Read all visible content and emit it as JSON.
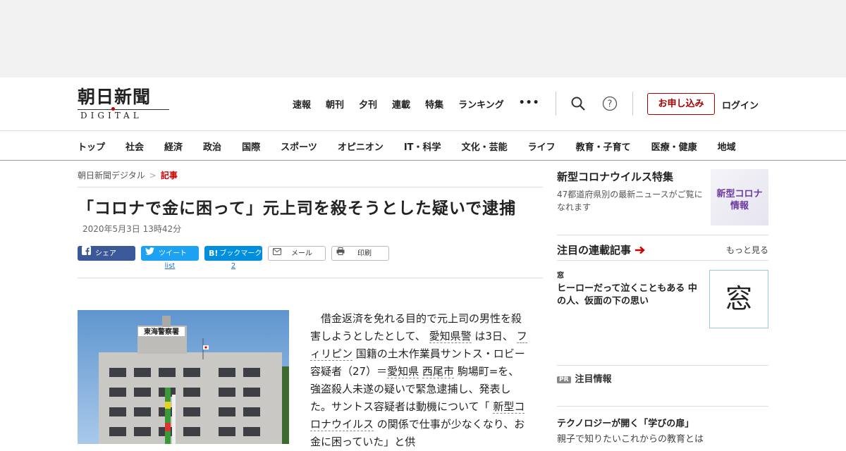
{
  "logo": {
    "title": "朝日新聞",
    "sub": "DIGITAL"
  },
  "topnav": [
    "速報",
    "朝刊",
    "夕刊",
    "連載",
    "特集",
    "ランキング",
    "•••"
  ],
  "header": {
    "signup": "お申し込み",
    "login": "ログイン"
  },
  "categories": [
    "トップ",
    "社会",
    "経済",
    "政治",
    "国際",
    "スポーツ",
    "オピニオン",
    "IT・科学",
    "文化・芸能",
    "ライフ",
    "教育・子育て",
    "医療・健康",
    "地域"
  ],
  "breadcrumb": {
    "home": "朝日新聞デジタル",
    "sep": ">",
    "current": "記事"
  },
  "article": {
    "title": "「コロナで金に困って」元上司を殺そうとした疑いで逮捕",
    "date": "2020年5月3日 13時42分",
    "body": {
      "t1": "借金返済を免れる目的で元上司の男性を殺害しようとしたとして、",
      "l1": "愛知県警",
      "t2": "は3日、",
      "l2": "フィリピン",
      "t3": "国籍の土木作業員サントス・ロビー容疑者（27）＝",
      "l3": "愛知県",
      "l4": "西尾市",
      "t4": "駒場町=を、強盗殺人未遂の疑いで緊急逮捕し、発表した。サントス容疑者は動機について「",
      "l5": "新型コロナウイルス",
      "t5": "の関係で仕事が少なくなり、お金に困っていた」と供"
    },
    "photo_sign": "東海警察署"
  },
  "share": {
    "facebook": "シェア",
    "twitter": "ツイート",
    "twitter_count": "list",
    "hatena": "ブックマーク",
    "hatena_count": "2",
    "mail": "メール",
    "print": "印刷"
  },
  "sidebar": {
    "corona": {
      "title": "新型コロナウイルス特集",
      "desc": "47都道府県別の最新ニュースがご覧になれます",
      "thumb_line1": "新型コロナ",
      "thumb_line2": "情報"
    },
    "series": {
      "heading": "注目の連載記事",
      "more": "もっと見る",
      "tag": "窓",
      "title": "ヒーローだって泣くこともある 中の人、仮面の下の思い",
      "thumb": "窓"
    },
    "pr": {
      "badge": "PR",
      "label": "注目情報"
    },
    "promo": {
      "title": "テクノロジーが開く「学びの扉」",
      "desc": "親子で知りたいこれからの教育とは"
    }
  },
  "colors": {
    "accent": "#c00000",
    "facebook": "#3b5998",
    "twitter": "#1da1f2",
    "hatena": "#008fde"
  }
}
